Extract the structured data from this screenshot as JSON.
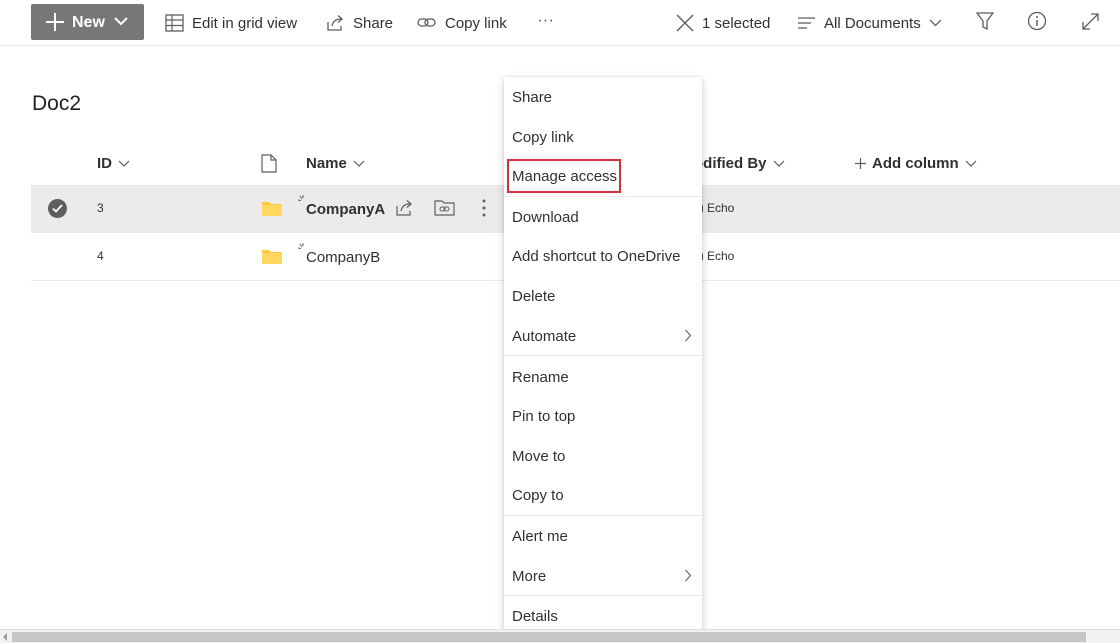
{
  "toolbar": {
    "new_label": "New",
    "grid_view_label": "Edit in grid view",
    "share_label": "Share",
    "copy_link_label": "Copy link",
    "more_glyph": "···",
    "selected_label": "1 selected",
    "view_label": "All Documents"
  },
  "library": {
    "title": "Doc2"
  },
  "columns": {
    "id": "ID",
    "name": "Name",
    "modified_by": "odified By",
    "add_column": "Add column"
  },
  "rows": [
    {
      "id": "3",
      "name": "CompanyA",
      "modified_by": "u Echo",
      "selected": true
    },
    {
      "id": "4",
      "name": "CompanyB",
      "modified_by": "u Echo",
      "selected": false
    }
  ],
  "context_menu": {
    "items": [
      {
        "label": "Share"
      },
      {
        "label": "Copy link"
      },
      {
        "label": "Manage access",
        "highlighted": true
      },
      {
        "label": "Download"
      },
      {
        "label": "Add shortcut to OneDrive"
      },
      {
        "label": "Delete"
      },
      {
        "label": "Automate",
        "submenu": true
      },
      {
        "label": "Rename"
      },
      {
        "label": "Pin to top"
      },
      {
        "label": "Move to"
      },
      {
        "label": "Copy to"
      },
      {
        "label": "Alert me"
      },
      {
        "label": "More",
        "submenu": true
      },
      {
        "label": "Details"
      }
    ]
  },
  "colors": {
    "new_button": "#797775",
    "selected_row": "#edebe9",
    "folder": "#ffc83d",
    "highlight": "#d13438"
  }
}
